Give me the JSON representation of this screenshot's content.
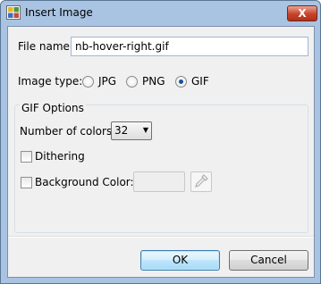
{
  "window": {
    "title": "Insert Image",
    "close_label": "X"
  },
  "file": {
    "label": "File name:",
    "value": "nb-hover-right.gif"
  },
  "image_type": {
    "label": "Image type:",
    "options": [
      "JPG",
      "PNG",
      "GIF"
    ],
    "selected": "GIF"
  },
  "gif_options": {
    "legend": "GIF Options",
    "colors_label": "Number of colors:",
    "colors_value": "32",
    "dithering_label": "Dithering",
    "dithering_checked": false,
    "background_label": "Background Color:",
    "background_checked": false
  },
  "buttons": {
    "ok": "OK",
    "cancel": "Cancel"
  }
}
